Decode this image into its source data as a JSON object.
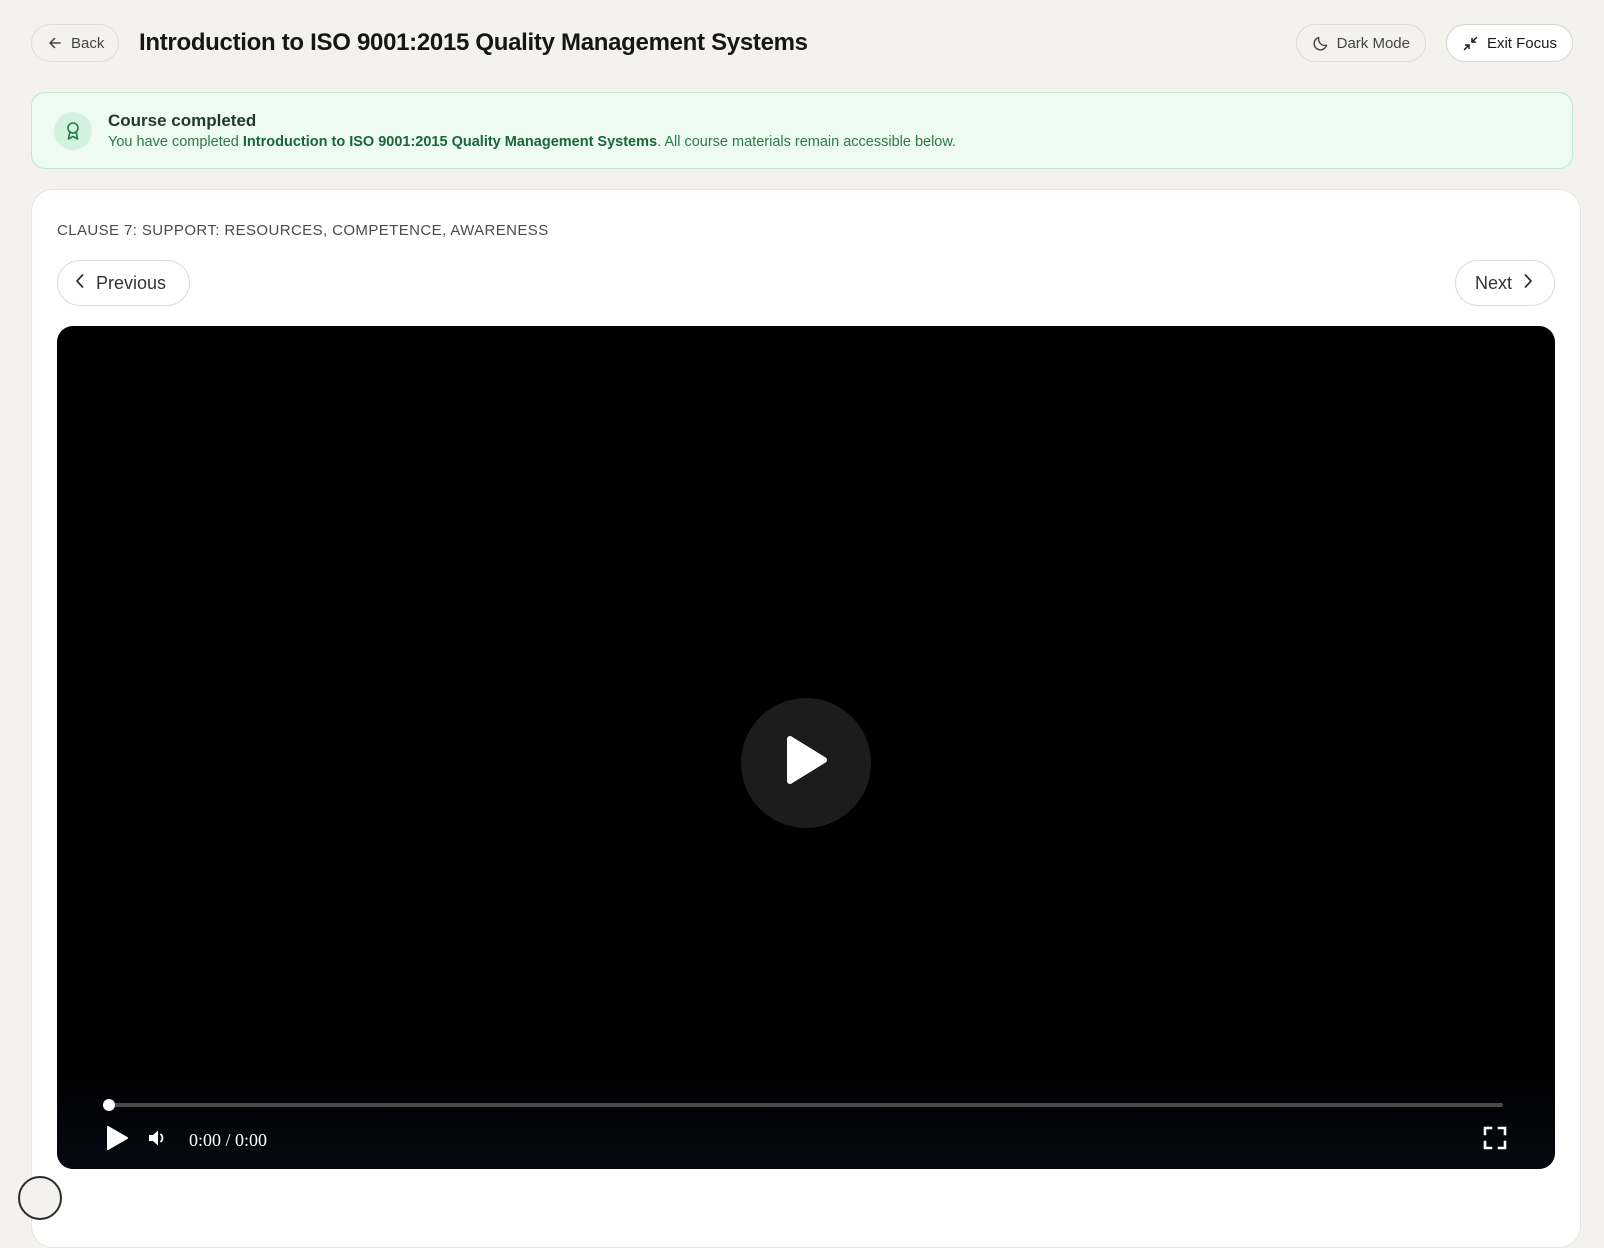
{
  "header": {
    "back_label": "Back",
    "title": "Introduction to ISO 9001:2015 Quality Management Systems",
    "dark_mode_label": "Dark Mode",
    "exit_focus_label": "Exit Focus"
  },
  "banner": {
    "title": "Course completed",
    "message_prefix": "You have completed ",
    "course_name": "Introduction to ISO 9001:2015 Quality Management Systems",
    "message_suffix": ". All course materials remain accessible below.",
    "colors": {
      "background": "#edfbf1",
      "border": "#bfe8cc",
      "text": "#2b7a48"
    }
  },
  "lesson": {
    "section_label": "CLAUSE 7: SUPPORT: RESOURCES, COMPETENCE, AWARENESS",
    "previous_label": "Previous",
    "next_label": "Next"
  },
  "video": {
    "time_display": "0:00 / 0:00",
    "progress": 0,
    "icons": {
      "big_play": "play-icon",
      "play": "play-icon",
      "volume": "volume-icon",
      "fullscreen": "fullscreen-icon"
    }
  }
}
